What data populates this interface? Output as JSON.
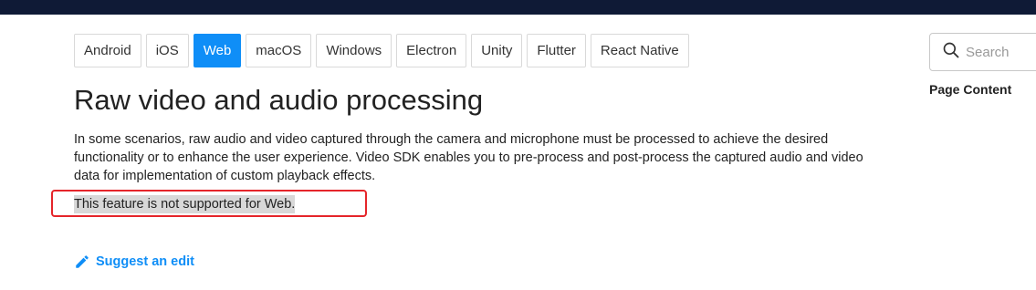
{
  "platform_tabs": [
    {
      "label": "Android",
      "active": false
    },
    {
      "label": "iOS",
      "active": false
    },
    {
      "label": "Web",
      "active": true
    },
    {
      "label": "macOS",
      "active": false
    },
    {
      "label": "Windows",
      "active": false
    },
    {
      "label": "Electron",
      "active": false
    },
    {
      "label": "Unity",
      "active": false
    },
    {
      "label": "Flutter",
      "active": false
    },
    {
      "label": "React Native",
      "active": false
    }
  ],
  "main": {
    "title": "Raw video and audio processing",
    "intro": "In some scenarios, raw audio and video captured through the camera and microphone must be processed to achieve the desired functionality or to enhance the user experience. Video SDK enables you to pre-process and post-process the captured audio and video data for implementation of custom playback effects.",
    "notice": "This feature is not supported for Web.",
    "suggest_edit": "Suggest an edit"
  },
  "sidebar": {
    "search_placeholder": "Search",
    "page_content_heading": "Page Content"
  },
  "colors": {
    "top_bar": "#0f1a36",
    "accent": "#0f8ef7",
    "highlight_border": "#e5252a"
  },
  "icons": {
    "suggest_edit": "pencil-icon",
    "search": "search-icon"
  }
}
